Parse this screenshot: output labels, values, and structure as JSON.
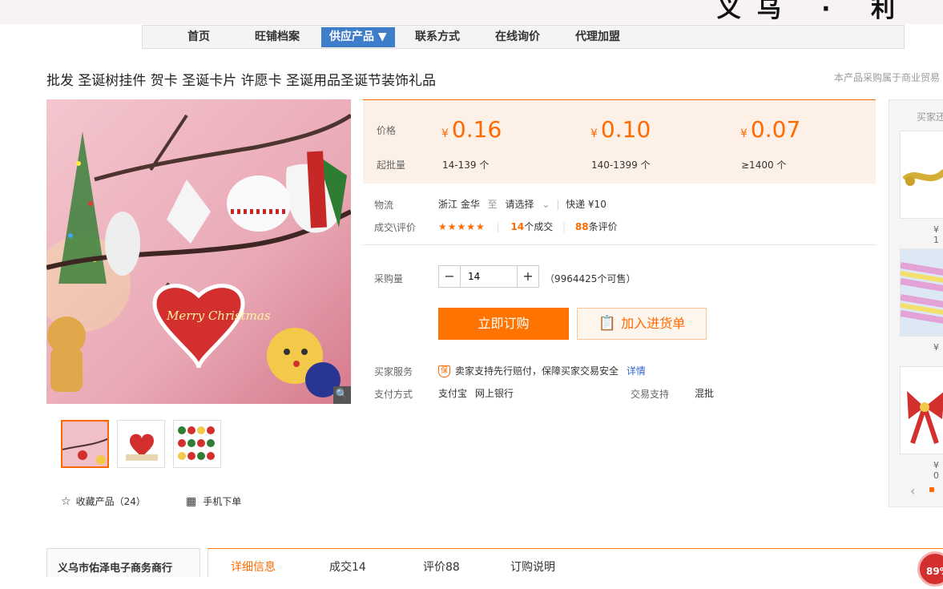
{
  "nav": {
    "items": [
      "首页",
      "旺铺档案",
      "供应产品 ▼",
      "联系方式",
      "在线询价",
      "代理加盟"
    ]
  },
  "product": {
    "title": "批发 圣诞树挂件 贺卡 圣诞卡片 许愿卡 圣诞用品圣诞节装饰礼品",
    "note": "本产品采购属于商业贸易"
  },
  "pricing": {
    "price_label": "价格",
    "qty_label": "起批量",
    "currency": "¥",
    "tiers": [
      {
        "price": "0.16",
        "qty": "14-139 个"
      },
      {
        "price": "0.10",
        "qty": "140-1399 个"
      },
      {
        "price": "0.07",
        "qty": "≥1400 个"
      }
    ]
  },
  "logistics": {
    "label": "物流",
    "from": "浙江 金华",
    "to_word": "至",
    "select": "请选择",
    "express": "快递 ¥10"
  },
  "deals": {
    "label": "成交\\评价",
    "stars": "★★★★★",
    "deal_count": "14",
    "deal_suffix": "个成交",
    "review_count": "88",
    "review_suffix": "条评价"
  },
  "purchase": {
    "label": "采购量",
    "quantity": "14",
    "minus": "−",
    "plus": "+",
    "available": "（9964425个可售）",
    "buy_now": "立即订购",
    "add_cart": "加入进货单"
  },
  "services": {
    "buyer_label": "买家服务",
    "buyer_badge": "保",
    "buyer_text": "卖家支持先行赔付，保障买家交易安全",
    "detail_link": "详情",
    "pay_label": "支付方式",
    "pay_alipay": "支付宝",
    "pay_bank": "网上银行",
    "trade_label": "交易支持",
    "trade_value": "混批"
  },
  "gallery": {
    "card_text": "Merry Christmas",
    "fav_label": "收藏产品（24）",
    "mobile_label": "手机下单"
  },
  "sidebar": {
    "header": "买家还",
    "prices": [
      "¥ 1",
      "¥",
      "¥ 0"
    ]
  },
  "store": {
    "name": "义乌市佑泽电子商务商行"
  },
  "tabs": [
    "详细信息",
    "成交14",
    "评价88",
    "订购说明"
  ],
  "badge": "89%",
  "colors": {
    "accent": "#ff6a00",
    "nav_active": "#3d7dca"
  }
}
